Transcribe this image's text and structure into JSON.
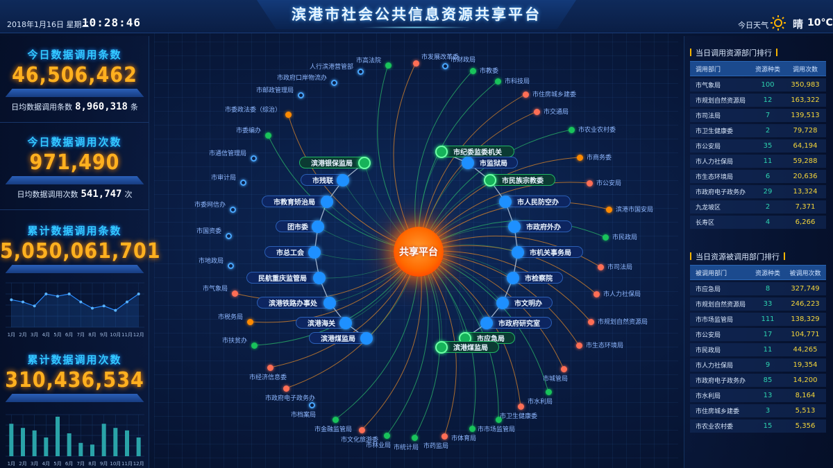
{
  "header": {
    "title": "滨港市社会公共信息资源共享平台",
    "date": "2018年1月16日 星期二",
    "time": "10:28:46",
    "weather_label": "今日天气",
    "weather_icon": "sun-icon",
    "weather_condition": "晴",
    "temperature": "10°C"
  },
  "left": {
    "today_records": {
      "title": "今日数据调用条数",
      "value": "46,506,462",
      "avg_label": "日均数据调用条数",
      "avg_value": "8,960,318",
      "avg_unit": "条"
    },
    "today_calls": {
      "title": "今日数据调用次数",
      "value": "971,490",
      "avg_label": "日均数据调用次数",
      "avg_value": "541,747",
      "avg_unit": "次"
    },
    "total_records": {
      "title": "累计数据调用条数",
      "value": "5,050,061,701"
    },
    "total_calls": {
      "title": "累计数据调用次数",
      "value": "310,436,534"
    }
  },
  "chart_data": [
    {
      "type": "line",
      "title": "累计数据调用条数",
      "categories": [
        "1月",
        "2月",
        "3月",
        "4月",
        "5月",
        "6月",
        "7月",
        "8月",
        "9月",
        "10月",
        "11月",
        "12月"
      ],
      "values": [
        62,
        57,
        48,
        75,
        70,
        75,
        57,
        43,
        48,
        38,
        57,
        75
      ],
      "ylim": [
        0,
        100
      ],
      "grid": true
    },
    {
      "type": "bar",
      "title": "累计数据调用次数",
      "categories": [
        "1月",
        "2月",
        "3月",
        "4月",
        "5月",
        "6月",
        "7月",
        "8月",
        "9月",
        "10月",
        "11月",
        "12月"
      ],
      "values": [
        78,
        68,
        62,
        45,
        95,
        55,
        32,
        28,
        78,
        68,
        62,
        45
      ],
      "ylim": [
        0,
        100
      ],
      "grid": true
    }
  ],
  "right": {
    "caller_rank": {
      "title": "当日调用资源部门排行",
      "headers": [
        "调用部门",
        "资源种类",
        "调用次数"
      ],
      "rows": [
        [
          "市气象局",
          "100",
          "350,983"
        ],
        [
          "市规划自然资源局",
          "12",
          "163,322"
        ],
        [
          "市司法局",
          "7",
          "139,513"
        ],
        [
          "市卫生健康委",
          "2",
          "79,728"
        ],
        [
          "市公安局",
          "35",
          "64,194"
        ],
        [
          "市人力社保局",
          "11",
          "59,288"
        ],
        [
          "市生态环境局",
          "6",
          "20,636"
        ],
        [
          "市政府电子政务办",
          "29",
          "13,324"
        ],
        [
          "九龙坡区",
          "2",
          "7,371"
        ],
        [
          "长寿区",
          "4",
          "6,266"
        ]
      ]
    },
    "callee_rank": {
      "title": "当日资源被调用部门排行",
      "headers": [
        "被调用部门",
        "资源种类",
        "被调用次数"
      ],
      "rows": [
        [
          "市应急局",
          "8",
          "327,749"
        ],
        [
          "市规划自然资源局",
          "33",
          "246,223"
        ],
        [
          "市市场监管局",
          "111",
          "138,329"
        ],
        [
          "市公安局",
          "17",
          "104,771"
        ],
        [
          "市民政局",
          "11",
          "44,265"
        ],
        [
          "市人力社保局",
          "9",
          "19,354"
        ],
        [
          "市政府电子政务办",
          "85",
          "14,200"
        ],
        [
          "市水利局",
          "13",
          "8,164"
        ],
        [
          "市住房城乡建委",
          "3",
          "5,513"
        ],
        [
          "市农业农村委",
          "15",
          "5,356"
        ]
      ]
    }
  },
  "network": {
    "hub": "共享平台",
    "inner_nodes": [
      {
        "name": "滨港银保监局",
        "color": "green"
      },
      {
        "name": "市残联",
        "color": "blue"
      },
      {
        "name": "市教育矫治局",
        "color": "blue"
      },
      {
        "name": "团市委",
        "color": "blue"
      },
      {
        "name": "市总工会",
        "color": "blue"
      },
      {
        "name": "民航重庆监管局",
        "color": "blue"
      },
      {
        "name": "滨港铁路办事处",
        "color": "blue"
      },
      {
        "name": "滨港海关",
        "color": "blue"
      },
      {
        "name": "滨港煤监局",
        "color": "blue"
      },
      {
        "name": "市纪委监委机关",
        "color": "green"
      },
      {
        "name": "市监狱局",
        "color": "blue"
      },
      {
        "name": "市民族宗教委",
        "color": "green"
      },
      {
        "name": "市人民防空办",
        "color": "blue"
      },
      {
        "name": "市政府外办",
        "color": "blue"
      },
      {
        "name": "市机关事务局",
        "color": "blue"
      },
      {
        "name": "市检察院",
        "color": "blue"
      },
      {
        "name": "市文明办",
        "color": "blue"
      },
      {
        "name": "市政府研究室",
        "color": "blue"
      },
      {
        "name": "市应急局",
        "color": "green"
      },
      {
        "name": "滨港煤监局",
        "color": "green"
      }
    ],
    "outer_nodes": [
      {
        "name": "市高法院",
        "color": "green"
      },
      {
        "name": "人行滨港营管部",
        "color": "ring"
      },
      {
        "name": "市政府口岸物流办",
        "color": "ring"
      },
      {
        "name": "市邮政管理局",
        "color": "ring"
      },
      {
        "name": "市委政法委（综治）",
        "color": "orange"
      },
      {
        "name": "市委编办",
        "color": "green"
      },
      {
        "name": "市通信管理局",
        "color": "ring"
      },
      {
        "name": "市审计局",
        "color": "ring"
      },
      {
        "name": "市委网信办",
        "color": "ring"
      },
      {
        "name": "市国资委",
        "color": "ring"
      },
      {
        "name": "市地政局",
        "color": "ring"
      },
      {
        "name": "市气象局",
        "color": "red"
      },
      {
        "name": "市税务局",
        "color": "orange"
      },
      {
        "name": "市扶贫办",
        "color": "green"
      },
      {
        "name": "市经济信息委",
        "color": "red"
      },
      {
        "name": "市政府电子政务办",
        "color": "red"
      },
      {
        "name": "市档案局",
        "color": "ring"
      },
      {
        "name": "市金融监管局",
        "color": "green"
      },
      {
        "name": "市文化旅游委",
        "color": "red"
      },
      {
        "name": "市林业局",
        "color": "green"
      },
      {
        "name": "市统计局",
        "color": "green"
      },
      {
        "name": "市药监局",
        "color": "red"
      },
      {
        "name": "市体育局",
        "color": "green"
      },
      {
        "name": "市市场监管局",
        "color": "green"
      },
      {
        "name": "市卫生健康委",
        "color": "red"
      },
      {
        "name": "市水利局",
        "color": "green"
      },
      {
        "name": "市城管局",
        "color": "red"
      },
      {
        "name": "市生态环境局",
        "color": "red"
      },
      {
        "name": "市规划自然资源局",
        "color": "red"
      },
      {
        "name": "市人力社保局",
        "color": "red"
      },
      {
        "name": "市司法局",
        "color": "red"
      },
      {
        "name": "市民政局",
        "color": "green"
      },
      {
        "name": "滨港市国安局",
        "color": "orange"
      },
      {
        "name": "市公安局",
        "color": "red"
      },
      {
        "name": "市商务委",
        "color": "orange"
      },
      {
        "name": "市农业农村委",
        "color": "green"
      },
      {
        "name": "市交通局",
        "color": "red"
      },
      {
        "name": "市住房城乡建委",
        "color": "red"
      },
      {
        "name": "市科技局",
        "color": "green"
      },
      {
        "name": "市教委",
        "color": "green"
      },
      {
        "name": "市财政局",
        "color": "ring"
      },
      {
        "name": "市发展改革委",
        "color": "red"
      }
    ]
  }
}
